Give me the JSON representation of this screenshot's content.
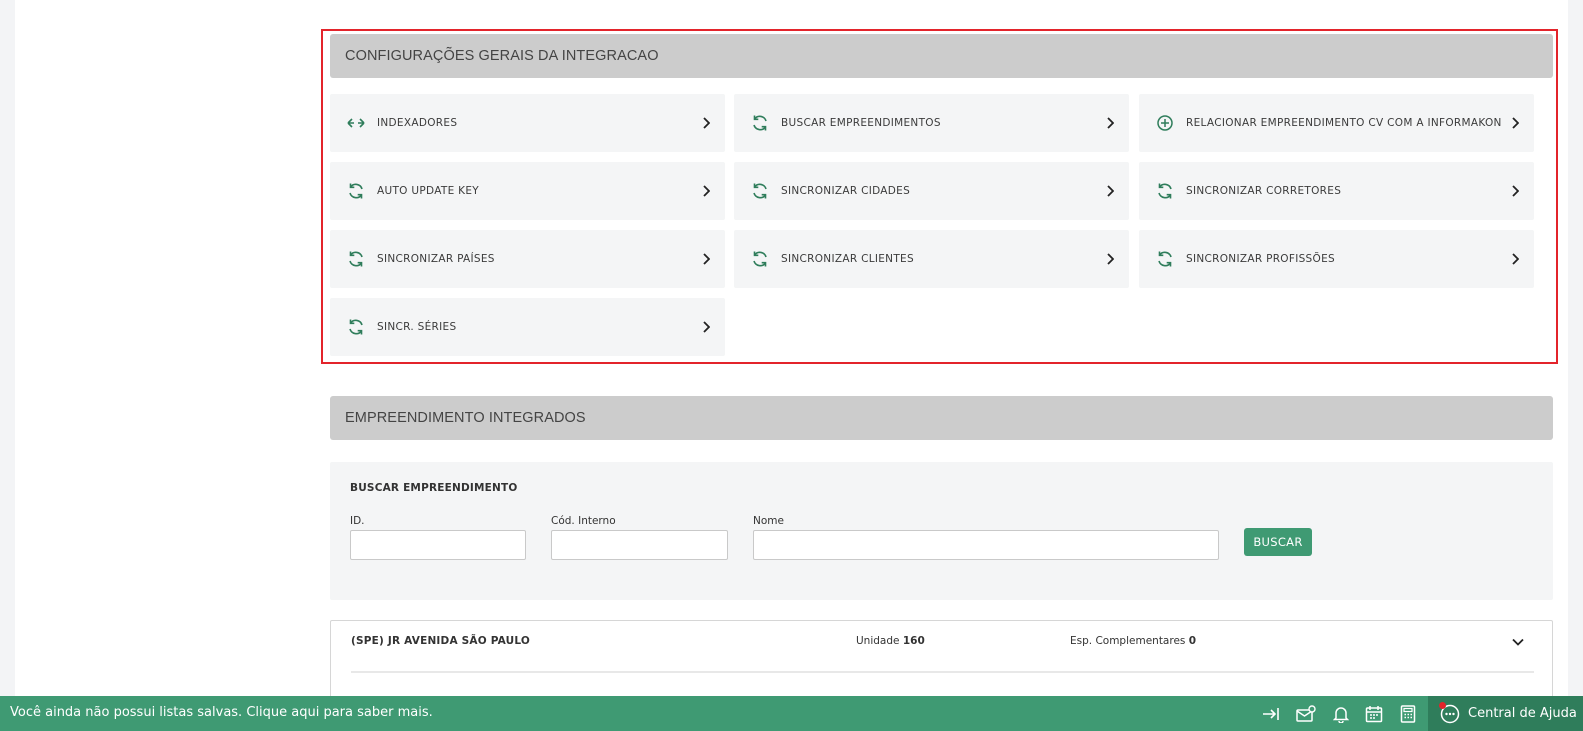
{
  "config_section": {
    "title": "CONFIGURAÇÕES GERAIS DA INTEGRACAO",
    "items": [
      {
        "label": "INDEXADORES",
        "icon": "arrows-horizontal-icon"
      },
      {
        "label": "BUSCAR EMPREENDIMENTOS",
        "icon": "sync-icon"
      },
      {
        "label": "RELACIONAR EMPREENDIMENTO CV COM A INFORMAKON",
        "icon": "plus-circle-icon"
      },
      {
        "label": "AUTO UPDATE KEY",
        "icon": "sync-icon"
      },
      {
        "label": "SINCRONIZAR CIDADES",
        "icon": "sync-icon"
      },
      {
        "label": "SINCRONIZAR CORRETORES",
        "icon": "sync-icon"
      },
      {
        "label": "SINCRONIZAR PAÍSES",
        "icon": "sync-icon"
      },
      {
        "label": "SINCRONIZAR CLIENTES",
        "icon": "sync-icon"
      },
      {
        "label": "SINCRONIZAR PROFISSÕES",
        "icon": "sync-icon"
      },
      {
        "label": "SINCR. SÉRIES",
        "icon": "sync-icon"
      }
    ]
  },
  "integrated_section": {
    "title": "EMPREENDIMENTO INTEGRADOS"
  },
  "search": {
    "title": "BUSCAR EMPREENDIMENTO",
    "id_label": "ID.",
    "id_value": "",
    "codigo_label": "Cód. Interno",
    "codigo_value": "",
    "nome_label": "Nome",
    "nome_value": "",
    "button_label": "BUSCAR"
  },
  "results": [
    {
      "name": "(SPE) JR AVENIDA SÃO PAULO",
      "unidade_label": "Unidade",
      "unidade_value": "160",
      "esp_label": "Esp. Complementares",
      "esp_value": "0"
    }
  ],
  "bottom_bar": {
    "message": "Você ainda não possui listas salvas. Clique aqui para saber mais.",
    "help_label": "Central de Ajuda",
    "icons": [
      "collapse-arrow-icon",
      "mail-settings-icon",
      "bell-icon",
      "calendar-icon",
      "calculator-icon"
    ]
  },
  "colors": {
    "accent": "#3f9a73",
    "accent_dark": "#2f7d5b",
    "highlight": "#e3242b",
    "section_header_bg": "#cccccc"
  }
}
